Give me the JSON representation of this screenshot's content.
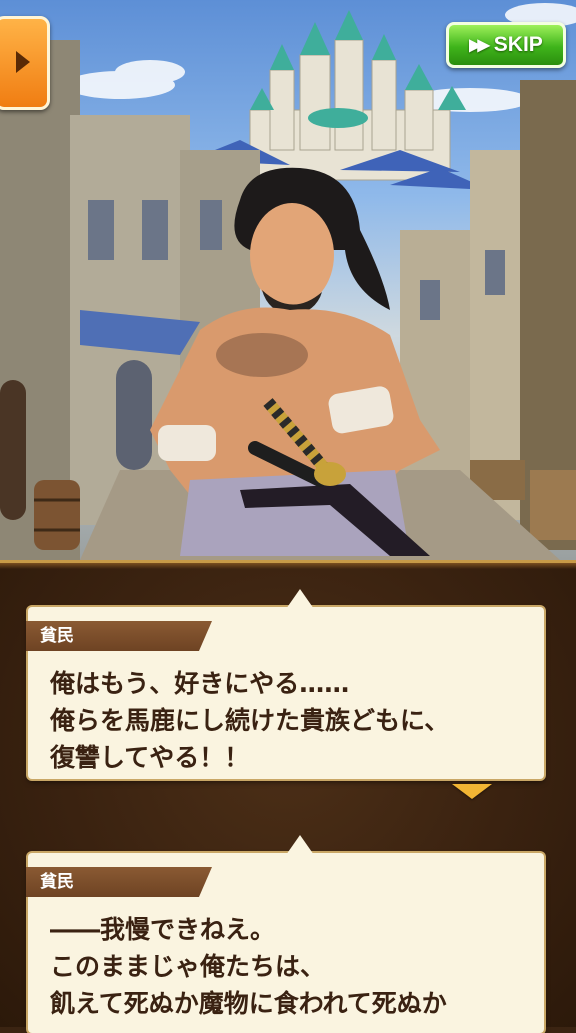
{
  "buttons": {
    "skip_label": "SKIP",
    "skip_icon": "fast-forward-icon",
    "menu_icon": "arrow-right-icon"
  },
  "dialogues": [
    {
      "speaker": "貧民",
      "lines": [
        "俺はもう、好きにやる……",
        "俺らを馬鹿にし続けた貴族どもに、",
        "復讐してやる！！"
      ]
    },
    {
      "speaker": "貧民",
      "lines": [
        "――我慢できねえ。",
        "このままじゃ俺たちは、",
        "飢えて死ぬか魔物に食われて死ぬか"
      ]
    }
  ],
  "colors": {
    "skip_green": "#3fb41b",
    "menu_orange": "#f07d12",
    "dialog_bg": "#faf4e0",
    "name_tag": "#7a4c28",
    "text": "#3a2212",
    "next_indicator": "#f2b534"
  }
}
